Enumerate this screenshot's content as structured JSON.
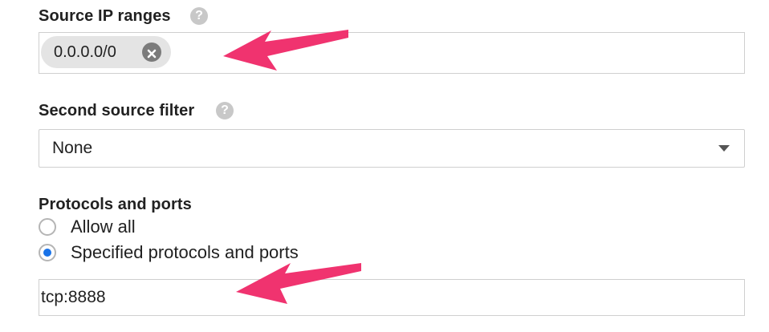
{
  "source_ip": {
    "label": "Source IP ranges",
    "help_icon": "help-icon",
    "chips": [
      {
        "value": "0.0.0.0/0",
        "remove_icon": "close-icon"
      }
    ]
  },
  "second_filter": {
    "label": "Second source filter",
    "help_icon": "help-icon",
    "selected": "None"
  },
  "protocols": {
    "label": "Protocols and ports",
    "options": [
      {
        "label": "Allow all",
        "checked": false
      },
      {
        "label": "Specified protocols and ports",
        "checked": true
      }
    ],
    "value": "tcp:8888"
  },
  "annotations": {
    "arrow_color": "#f0336f"
  }
}
